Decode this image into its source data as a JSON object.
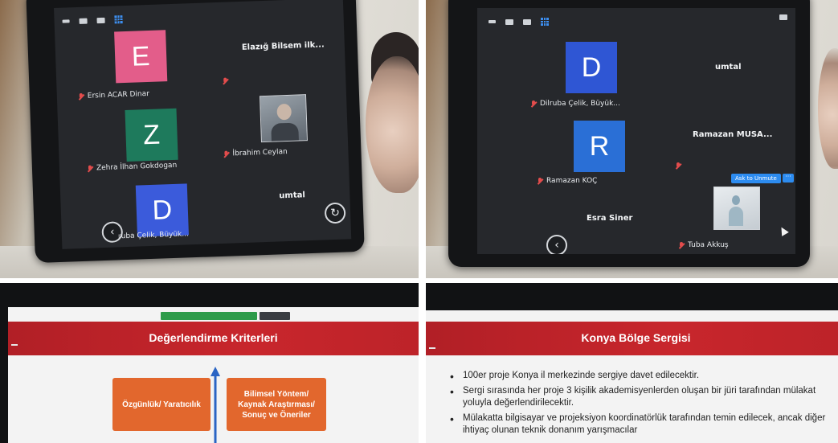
{
  "panels": {
    "top_left": {
      "tiles": [
        {
          "initial": "E",
          "color": "#e35d8a",
          "name": "Ersin ACAR Dinar"
        },
        {
          "initial": "Z",
          "color": "#1e7a5c",
          "name": "Zehra İlhan Gokdogan"
        },
        {
          "initial": "D",
          "color": "#3b5bdb",
          "name": "ruba Çelik, Büyük..."
        }
      ],
      "labels": {
        "elazig": "Elazığ Bilsem ilk...",
        "ibrahim": "İbrahim Ceylan",
        "umtal": "umtal"
      }
    },
    "top_right": {
      "tiles": [
        {
          "initial": "D",
          "color": "#2f56d4",
          "name": "Dilruba Çelik, Büyük..."
        },
        {
          "initial": "R",
          "color": "#2a6fd6",
          "name": "Ramazan KOÇ"
        }
      ],
      "labels": {
        "umtal": "umtal",
        "ramazan_musa": "Ramazan MUSA...",
        "esra": "Esra Siner",
        "tuba": "Tuba Akkuş"
      },
      "buttons": {
        "unmute": "Ask to Unmute",
        "more": "···"
      }
    },
    "bottom_left": {
      "title": "Değerlendirme Kriterleri",
      "box1": "Özgünlük/ Yaratıcılık",
      "box2": "Bilimsel Yöntem/ Kaynak Araştırması/ Sonuç ve Öneriler"
    },
    "bottom_right": {
      "title": "Konya Bölge Sergisi",
      "bullets": [
        "100er proje Konya il merkezinde sergiye davet edilecektir.",
        "Sergi sırasında her proje 3 kişilik akademisyenlerden oluşan bir jüri tarafından mülakat yoluyla değerlendirilecektir.",
        "Mülakatta bilgisayar ve projeksiyon koordinatörlük tarafından temin edilecek, ancak diğer ihtiyaç olunan teknik donanım yarışmacılar"
      ]
    }
  },
  "icons": {
    "mic_muted": "mic-muted-icon",
    "nav_back": "chevron-left-icon",
    "nav_rotate": "rotate-icon",
    "gallery": "gallery-view-icon"
  }
}
